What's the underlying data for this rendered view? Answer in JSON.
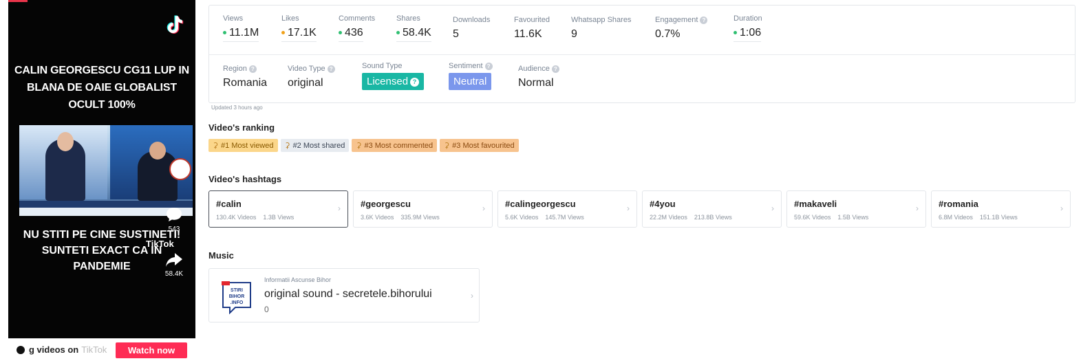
{
  "video": {
    "caption_top": "CALIN GEORGESCU CG11 LUP IN BLANA DE OAIE GLOBALIST OCULT 100%",
    "caption_bottom": "NU STITI PE CINE SUSTINETI! SUNTETI EXACT CA IN PANDEMIE",
    "tiktok_watermark": "TikTok",
    "comments_count": "543",
    "shares_count": "58.4K",
    "bottom_text": "g videos on",
    "bottom_text_faded": "TikTok",
    "watch_label": "Watch now",
    "accent": "#fe2c55"
  },
  "stats": [
    {
      "label": "Views",
      "value": "11.1M",
      "dot": "green",
      "help": false
    },
    {
      "label": "Likes",
      "value": "17.1K",
      "dot": "orange",
      "help": false
    },
    {
      "label": "Comments",
      "value": "436",
      "dot": "green",
      "help": false
    },
    {
      "label": "Shares",
      "value": "58.4K",
      "dot": "green",
      "help": false
    },
    {
      "label": "Downloads",
      "value": "5",
      "dot": "",
      "help": false
    },
    {
      "label": "Favourited",
      "value": "11.6K",
      "dot": "",
      "help": false
    },
    {
      "label": "Whatsapp Shares",
      "value": "9",
      "dot": "",
      "help": false
    },
    {
      "label": "Engagement",
      "value": "0.7%",
      "dot": "",
      "help": true
    },
    {
      "label": "Duration",
      "value": "1:06",
      "dot": "green",
      "help": false
    }
  ],
  "meta": {
    "region_label": "Region",
    "region_value": "Romania",
    "video_type_label": "Video Type",
    "video_type_value": "original",
    "sound_type_label": "Sound Type",
    "sound_type_value": "Licensed",
    "sentiment_label": "Sentiment",
    "sentiment_value": "Neutral",
    "audience_label": "Audience",
    "audience_value": "Normal",
    "help_glyph": "?"
  },
  "updated": "Updated 3 hours ago",
  "ranking": {
    "title": "Video's ranking",
    "items": [
      {
        "label": "#1 Most viewed",
        "color": "yellow"
      },
      {
        "label": "#2 Most shared",
        "color": "gray"
      },
      {
        "label": "#3 Most commented",
        "color": "orange"
      },
      {
        "label": "#3 Most favourited",
        "color": "orange"
      }
    ]
  },
  "hashtags": {
    "title": "Video's hashtags",
    "items": [
      {
        "name": "#calin",
        "videos": "130.4K Videos",
        "views": "1.3B Views"
      },
      {
        "name": "#georgescu",
        "videos": "3.6K Videos",
        "views": "335.9M Views"
      },
      {
        "name": "#calingeorgescu",
        "videos": "5.6K Videos",
        "views": "145.7M Views"
      },
      {
        "name": "#4you",
        "videos": "22.2M Videos",
        "views": "213.8B Views"
      },
      {
        "name": "#makaveli",
        "videos": "59.6K Videos",
        "views": "1.5B Views"
      },
      {
        "name": "#romania",
        "videos": "6.8M Videos",
        "views": "151.1B Views"
      }
    ]
  },
  "music": {
    "title": "Music",
    "artist": "Informatii Ascunse Bihor",
    "track": "original sound - secretele.bihorului",
    "count": "0",
    "logo_text": [
      "STIRI",
      "BIHOR",
      ".INFO"
    ]
  },
  "icons": [
    "tiktok-logo-icon",
    "help-icon",
    "trophy-icon",
    "chevron-right-icon",
    "share-icon",
    "comment-icon"
  ]
}
